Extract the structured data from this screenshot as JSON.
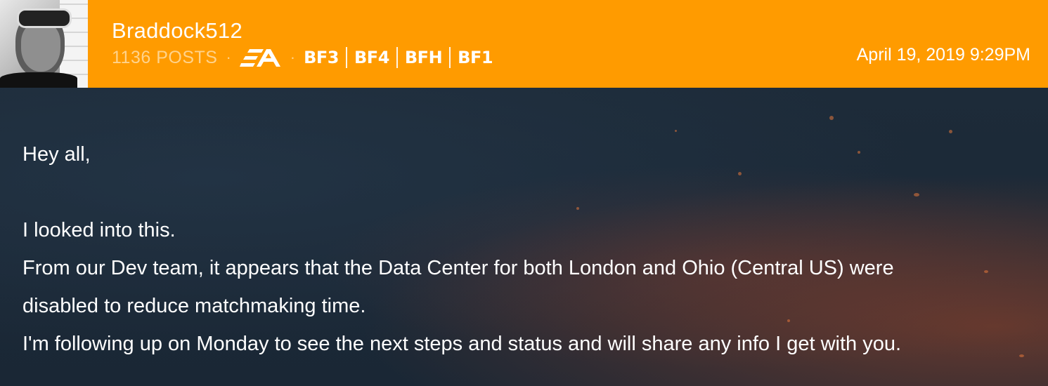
{
  "post": {
    "author": {
      "username": "Braddock512",
      "post_count": "1136 POSTS",
      "separator": "·",
      "publisher_logo_icon": "ea-logo-icon",
      "game_badges": [
        "BF3",
        "BF4",
        "BFH",
        "BF1"
      ]
    },
    "timestamp": "April 19, 2019 9:29PM",
    "message": {
      "greeting": "Hey all,",
      "line1": "I looked into this.",
      "line2": "From our Dev team, it appears that the Data Center for both London and Ohio (Central US) were",
      "line3": "disabled to reduce matchmaking time.",
      "line4": "I'm following up on Monday to see the next steps and status and will share any info I get with you."
    }
  },
  "colors": {
    "header_bg": "#ff9b00",
    "body_bg": "#1c2a38",
    "text": "#ffffff",
    "post_count": "#ffd38c"
  }
}
